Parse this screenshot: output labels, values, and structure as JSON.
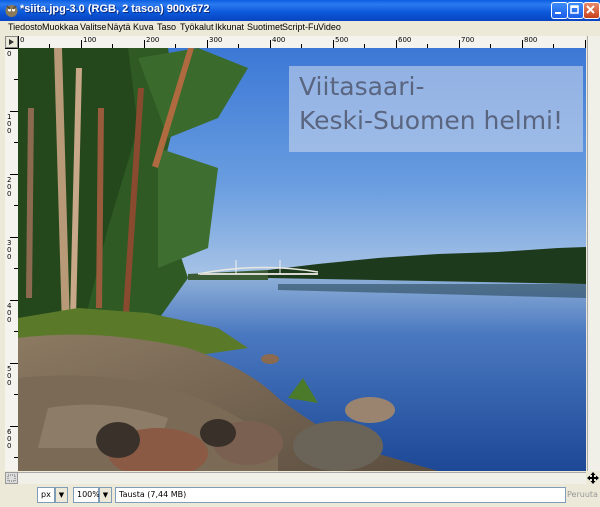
{
  "window": {
    "title": "*siita.jpg-3.0 (RGB, 2 tasoa) 900x672",
    "buttons": [
      "minimize",
      "maximize",
      "close"
    ]
  },
  "menubar": {
    "items": [
      "Tiedosto",
      "Muokkaa",
      "Valitse",
      "Näytä",
      "Kuva",
      "Taso",
      "Työkalut",
      "Ikkunat",
      "Suotimet",
      "Script-Fu",
      "Video"
    ]
  },
  "ruler": {
    "horizontal": [
      "0",
      "100",
      "200",
      "300",
      "400",
      "500",
      "600",
      "700",
      "800"
    ],
    "vertical": [
      "0",
      "100",
      "200",
      "300",
      "400",
      "500",
      "600"
    ]
  },
  "image": {
    "overlay_line1": "Viitasaari-",
    "overlay_line2": "Keski-Suomen helmi!"
  },
  "statusbar": {
    "unit": "px",
    "zoom": "100%",
    "layer_info": "Tausta (7,44 MB)",
    "cancel_label": "Peruuta"
  },
  "colors": {
    "titlebar": "#0a58d8",
    "sky": "#4a86d8",
    "water": "#2a5aa8",
    "overlay_panel": "#b8c8e8"
  }
}
